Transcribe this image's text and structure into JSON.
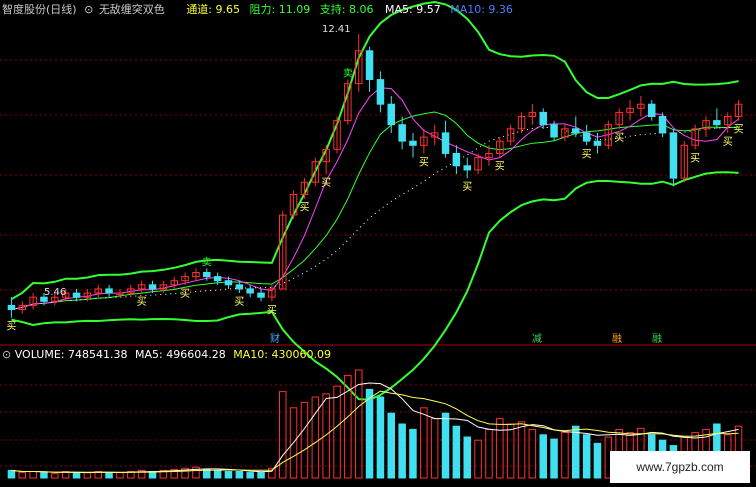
{
  "app": {
    "title": "智度股份(日线)",
    "indicator_name": "无敌缠突双色"
  },
  "main_header": {
    "channel_label": "通道:",
    "channel_value": "9.65",
    "resistance_label": "阻力:",
    "resistance_value": "11.09",
    "support_label": "支持:",
    "support_value": "8.06",
    "ma5_label": "MA5:",
    "ma5_value": "9.57",
    "ma10_partial": "MA10: 9.36"
  },
  "price_marks": {
    "high_label": "12.41",
    "low_label": "5.46"
  },
  "signal_labels": {
    "buy": "买",
    "sell": "卖"
  },
  "event_markers": [
    {
      "text": "财",
      "color": "#4aa3ff"
    },
    {
      "text": "减",
      "color": "#39d353"
    },
    {
      "text": "融",
      "color": "#ff9f1c"
    },
    {
      "text": "融",
      "color": "#39d353"
    }
  ],
  "volume_header": {
    "volume_label": "VOLUME:",
    "volume_value": "748541.38",
    "ma5_label": "MA5:",
    "ma5_value": "496604.28",
    "ma10_label": "MA10:",
    "ma10_value": "430060.09"
  },
  "watermark": "www.7gpzb.com",
  "colors": {
    "up": "#ff3030",
    "down": "#40e0f0",
    "band": "#33ff33",
    "ma5": "#ffffff",
    "ma10": "#ffff55",
    "ma_magenta": "#ff44ff",
    "grid": "#8b0000"
  },
  "chart_data": {
    "type": "candlestick",
    "price_range": [
      5.2,
      12.8
    ],
    "candles": [
      [
        5.8,
        6.0,
        5.5,
        5.7
      ],
      [
        5.7,
        5.9,
        5.6,
        5.8
      ],
      [
        5.8,
        6.1,
        5.7,
        6.0
      ],
      [
        6.0,
        6.1,
        5.8,
        5.9
      ],
      [
        5.9,
        6.1,
        5.8,
        6.0
      ],
      [
        6.0,
        6.2,
        5.9,
        6.1
      ],
      [
        6.1,
        6.2,
        5.9,
        6.0
      ],
      [
        6.0,
        6.2,
        5.9,
        6.1
      ],
      [
        6.1,
        6.3,
        6.0,
        6.2
      ],
      [
        6.2,
        6.3,
        6.0,
        6.1
      ],
      [
        6.1,
        6.2,
        6.0,
        6.1
      ],
      [
        6.1,
        6.3,
        6.0,
        6.2
      ],
      [
        6.2,
        6.4,
        6.1,
        6.3
      ],
      [
        6.3,
        6.4,
        6.1,
        6.2
      ],
      [
        6.2,
        6.4,
        6.1,
        6.3
      ],
      [
        6.3,
        6.5,
        6.2,
        6.4
      ],
      [
        6.4,
        6.6,
        6.3,
        6.5
      ],
      [
        6.5,
        6.7,
        6.4,
        6.6
      ],
      [
        6.6,
        6.7,
        6.4,
        6.5
      ],
      [
        6.5,
        6.6,
        6.3,
        6.4
      ],
      [
        6.4,
        6.5,
        6.2,
        6.3
      ],
      [
        6.3,
        6.4,
        6.1,
        6.2
      ],
      [
        6.2,
        6.3,
        6.0,
        6.1
      ],
      [
        6.1,
        6.2,
        5.9,
        6.0
      ],
      [
        6.0,
        6.3,
        5.9,
        6.2
      ],
      [
        6.2,
        8.1,
        6.2,
        8.0
      ],
      [
        8.0,
        8.6,
        7.9,
        8.5
      ],
      [
        8.5,
        8.9,
        8.4,
        8.8
      ],
      [
        8.8,
        9.4,
        8.7,
        9.3
      ],
      [
        9.3,
        9.7,
        9.0,
        9.6
      ],
      [
        9.6,
        10.4,
        9.5,
        10.3
      ],
      [
        10.3,
        11.3,
        10.2,
        11.2
      ],
      [
        11.2,
        12.41,
        11.0,
        12.0
      ],
      [
        12.0,
        12.1,
        11.0,
        11.3
      ],
      [
        11.3,
        11.5,
        10.5,
        10.7
      ],
      [
        10.7,
        10.9,
        10.0,
        10.2
      ],
      [
        10.2,
        10.4,
        9.6,
        9.8
      ],
      [
        9.8,
        10.0,
        9.4,
        9.7
      ],
      [
        9.7,
        10.1,
        9.5,
        9.9
      ],
      [
        9.9,
        10.2,
        9.7,
        10.0
      ],
      [
        10.0,
        10.3,
        9.4,
        9.5
      ],
      [
        9.5,
        9.7,
        9.0,
        9.2
      ],
      [
        9.2,
        9.4,
        8.9,
        9.1
      ],
      [
        9.1,
        9.5,
        9.0,
        9.4
      ],
      [
        9.4,
        9.7,
        9.2,
        9.5
      ],
      [
        9.5,
        9.9,
        9.4,
        9.8
      ],
      [
        9.8,
        10.2,
        9.7,
        10.1
      ],
      [
        10.1,
        10.5,
        10.0,
        10.4
      ],
      [
        10.4,
        10.7,
        10.2,
        10.5
      ],
      [
        10.5,
        10.6,
        10.1,
        10.2
      ],
      [
        10.2,
        10.3,
        9.8,
        9.9
      ],
      [
        9.9,
        10.2,
        9.8,
        10.1
      ],
      [
        10.1,
        10.4,
        9.9,
        10.0
      ],
      [
        10.0,
        10.2,
        9.7,
        9.8
      ],
      [
        9.8,
        10.0,
        9.5,
        9.7
      ],
      [
        9.7,
        10.3,
        9.6,
        10.2
      ],
      [
        10.2,
        10.6,
        10.1,
        10.5
      ],
      [
        10.5,
        10.8,
        10.3,
        10.6
      ],
      [
        10.6,
        10.9,
        10.4,
        10.7
      ],
      [
        10.7,
        10.8,
        10.3,
        10.4
      ],
      [
        10.4,
        10.5,
        9.9,
        10.0
      ],
      [
        10.0,
        10.1,
        8.7,
        8.9
      ],
      [
        8.9,
        9.8,
        8.8,
        9.7
      ],
      [
        9.7,
        10.2,
        9.6,
        10.1
      ],
      [
        10.1,
        10.4,
        9.9,
        10.3
      ],
      [
        10.3,
        10.6,
        10.1,
        10.2
      ],
      [
        10.2,
        10.5,
        10.0,
        10.4
      ],
      [
        10.4,
        10.8,
        10.3,
        10.7
      ]
    ],
    "volume": [
      0.07,
      0.05,
      0.06,
      0.05,
      0.04,
      0.06,
      0.05,
      0.05,
      0.06,
      0.05,
      0.05,
      0.06,
      0.07,
      0.06,
      0.07,
      0.08,
      0.09,
      0.1,
      0.08,
      0.07,
      0.06,
      0.06,
      0.05,
      0.05,
      0.09,
      0.8,
      0.65,
      0.7,
      0.75,
      0.78,
      0.85,
      0.95,
      1.0,
      0.82,
      0.75,
      0.6,
      0.5,
      0.45,
      0.65,
      0.55,
      0.6,
      0.48,
      0.38,
      0.35,
      0.45,
      0.55,
      0.5,
      0.52,
      0.45,
      0.4,
      0.36,
      0.42,
      0.48,
      0.4,
      0.32,
      0.38,
      0.45,
      0.42,
      0.46,
      0.4,
      0.35,
      0.3,
      0.38,
      0.42,
      0.45,
      0.5,
      0.4,
      0.48
    ],
    "volume_unit_max": 1200000
  }
}
